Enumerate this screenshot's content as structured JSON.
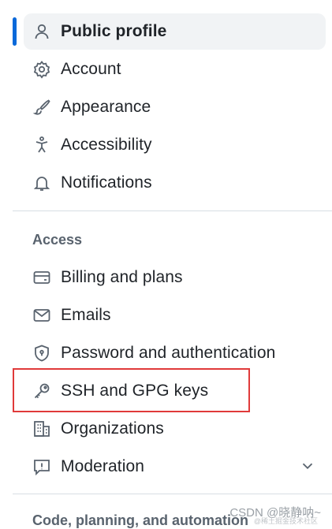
{
  "nav": {
    "items_top": [
      {
        "label": "Public profile",
        "icon": "person-icon",
        "selected": true
      },
      {
        "label": "Account",
        "icon": "gear-icon"
      },
      {
        "label": "Appearance",
        "icon": "paintbrush-icon"
      },
      {
        "label": "Accessibility",
        "icon": "accessibility-icon"
      },
      {
        "label": "Notifications",
        "icon": "bell-icon"
      }
    ],
    "section_access": "Access",
    "items_access": [
      {
        "label": "Billing and plans",
        "icon": "credit-card-icon"
      },
      {
        "label": "Emails",
        "icon": "mail-icon"
      },
      {
        "label": "Password and authentication",
        "icon": "shield-lock-icon"
      },
      {
        "label": "SSH and GPG keys",
        "icon": "key-icon"
      },
      {
        "label": "Organizations",
        "icon": "organization-icon"
      },
      {
        "label": "Moderation",
        "icon": "report-icon"
      }
    ],
    "section_code": "Code, planning, and automation"
  },
  "watermark": {
    "text": "CSDN @晓静呐~",
    "subtext": "@稀土掘金技术社区"
  },
  "colors": {
    "accent": "#0969da",
    "highlight": "#e03a3a",
    "selected_bg": "#f1f3f5"
  }
}
